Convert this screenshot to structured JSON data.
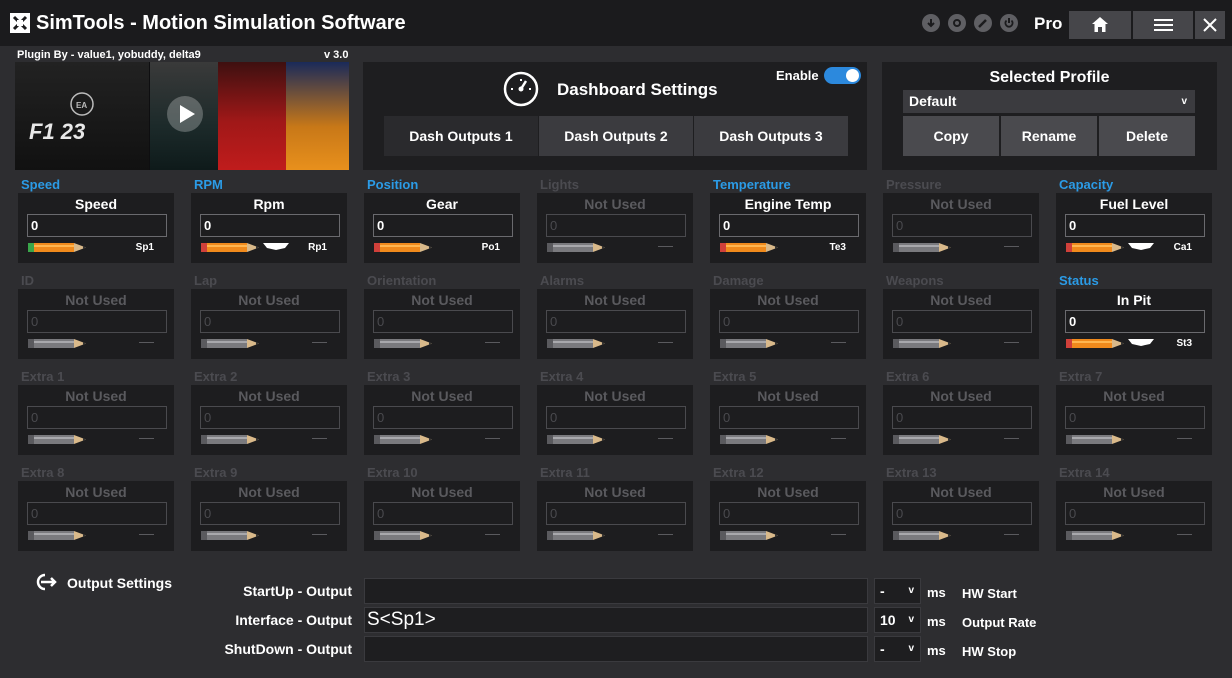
{
  "app": {
    "title": "SimTools - Motion Simulation Software",
    "tier": "Pro"
  },
  "plugin": {
    "credits": "Plugin By - value1, yobuddy, delta9",
    "version": "v 3.0",
    "game": "F1 23"
  },
  "dashboard": {
    "title": "Dashboard Settings",
    "enable_label": "Enable",
    "enabled": true,
    "tabs": [
      {
        "label": "Dash Outputs 1",
        "active": true
      },
      {
        "label": "Dash Outputs 2",
        "active": false
      },
      {
        "label": "Dash Outputs 3",
        "active": false
      }
    ]
  },
  "profile": {
    "title": "Selected Profile",
    "selected": "Default",
    "buttons": [
      "Copy",
      "Rename",
      "Delete"
    ]
  },
  "channels": [
    {
      "group": "Speed",
      "title": "Speed",
      "value": "0",
      "code": "Sp1",
      "active": true,
      "tip": "green",
      "chip": false
    },
    {
      "group": "RPM",
      "title": "Rpm",
      "value": "0",
      "code": "Rp1",
      "active": true,
      "tip": "red",
      "chip": true
    },
    {
      "group": "Position",
      "title": "Gear",
      "value": "0",
      "code": "Po1",
      "active": true,
      "tip": "red",
      "chip": false
    },
    {
      "group": "Lights",
      "title": "Not Used",
      "value": "0",
      "code": "",
      "active": false
    },
    {
      "group": "Temperature",
      "title": "Engine Temp",
      "value": "0",
      "code": "Te3",
      "active": true,
      "tip": "red",
      "chip": false
    },
    {
      "group": "Pressure",
      "title": "Not Used",
      "value": "0",
      "code": "",
      "active": false
    },
    {
      "group": "Capacity",
      "title": "Fuel Level",
      "value": "0",
      "code": "Ca1",
      "active": true,
      "tip": "red",
      "chip": true
    },
    {
      "group": "ID",
      "title": "Not Used",
      "value": "0",
      "code": "",
      "active": false
    },
    {
      "group": "Lap",
      "title": "Not Used",
      "value": "0",
      "code": "",
      "active": false
    },
    {
      "group": "Orientation",
      "title": "Not Used",
      "value": "0",
      "code": "",
      "active": false
    },
    {
      "group": "Alarms",
      "title": "Not Used",
      "value": "0",
      "code": "",
      "active": false
    },
    {
      "group": "Damage",
      "title": "Not Used",
      "value": "0",
      "code": "",
      "active": false
    },
    {
      "group": "Weapons",
      "title": "Not Used",
      "value": "0",
      "code": "",
      "active": false
    },
    {
      "group": "Status",
      "title": "In Pit",
      "value": "0",
      "code": "St3",
      "active": true,
      "tip": "red",
      "chip": true
    },
    {
      "group": "Extra 1",
      "title": "Not Used",
      "value": "0",
      "code": "",
      "active": false
    },
    {
      "group": "Extra 2",
      "title": "Not Used",
      "value": "0",
      "code": "",
      "active": false
    },
    {
      "group": "Extra 3",
      "title": "Not Used",
      "value": "0",
      "code": "",
      "active": false
    },
    {
      "group": "Extra 4",
      "title": "Not Used",
      "value": "0",
      "code": "",
      "active": false
    },
    {
      "group": "Extra 5",
      "title": "Not Used",
      "value": "0",
      "code": "",
      "active": false
    },
    {
      "group": "Extra 6",
      "title": "Not Used",
      "value": "0",
      "code": "",
      "active": false
    },
    {
      "group": "Extra 7",
      "title": "Not Used",
      "value": "0",
      "code": "",
      "active": false
    },
    {
      "group": "Extra 8",
      "title": "Not Used",
      "value": "0",
      "code": "",
      "active": false
    },
    {
      "group": "Extra 9",
      "title": "Not Used",
      "value": "0",
      "code": "",
      "active": false
    },
    {
      "group": "Extra 10",
      "title": "Not Used",
      "value": "0",
      "code": "",
      "active": false
    },
    {
      "group": "Extra 11",
      "title": "Not Used",
      "value": "0",
      "code": "",
      "active": false
    },
    {
      "group": "Extra 12",
      "title": "Not Used",
      "value": "0",
      "code": "",
      "active": false
    },
    {
      "group": "Extra 13",
      "title": "Not Used",
      "value": "0",
      "code": "",
      "active": false
    },
    {
      "group": "Extra 14",
      "title": "Not Used",
      "value": "0",
      "code": "",
      "active": false
    }
  ],
  "output": {
    "title": "Output Settings",
    "rows": [
      {
        "label": "StartUp - Output",
        "value": "",
        "select": "-",
        "unit": "ms",
        "hw": "HW Start"
      },
      {
        "label": "Interface - Output",
        "value": "S<Sp1>",
        "select": "10",
        "unit": "ms",
        "hw": "Output Rate"
      },
      {
        "label": "ShutDown - Output",
        "value": "",
        "select": "-",
        "unit": "ms",
        "hw": "HW Stop"
      }
    ]
  },
  "colors": {
    "accent": "#2b9be6",
    "toggle": "#2c89dd",
    "pencil_body": "#f08a1c",
    "pencil_tip_green": "#3aa64a",
    "pencil_tip_red": "#d0403a"
  },
  "icons": [
    "app-logo-icon",
    "download-icon",
    "settings-icon",
    "edit-icon",
    "power-icon",
    "home-icon",
    "menu-icon",
    "close-icon",
    "play-icon",
    "gauge-icon",
    "chevron-down-icon",
    "output-plug-icon",
    "pencil-icon"
  ]
}
